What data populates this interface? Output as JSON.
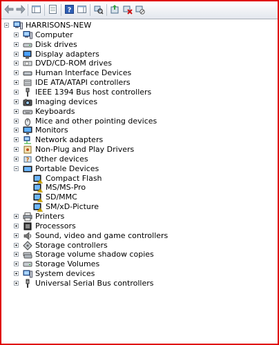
{
  "toolbar": {
    "buttons": [
      {
        "name": "back-arrow-icon"
      },
      {
        "name": "forward-arrow-icon"
      },
      {
        "name": "show-hide-console-tree-icon"
      },
      {
        "name": "properties-icon"
      },
      {
        "name": "help-icon"
      },
      {
        "name": "action-pane-icon"
      },
      {
        "name": "scan-hardware-changes-icon"
      },
      {
        "name": "update-driver-icon"
      },
      {
        "name": "uninstall-device-icon"
      },
      {
        "name": "disable-device-icon"
      }
    ]
  },
  "tree": {
    "root": "HARRISONS-NEW",
    "categories": [
      {
        "label": "Computer",
        "icon": "computer-icon"
      },
      {
        "label": "Disk drives",
        "icon": "disk-drive-icon"
      },
      {
        "label": "Display adapters",
        "icon": "display-adapter-icon"
      },
      {
        "label": "DVD/CD-ROM drives",
        "icon": "dvd-drive-icon"
      },
      {
        "label": "Human Interface Devices",
        "icon": "hid-icon"
      },
      {
        "label": "IDE ATA/ATAPI controllers",
        "icon": "ide-controller-icon"
      },
      {
        "label": "IEEE 1394 Bus host controllers",
        "icon": "ieee1394-icon"
      },
      {
        "label": "Imaging devices",
        "icon": "camera-icon"
      },
      {
        "label": "Keyboards",
        "icon": "keyboard-icon"
      },
      {
        "label": "Mice and other pointing devices",
        "icon": "mouse-icon"
      },
      {
        "label": "Monitors",
        "icon": "monitor-icon"
      },
      {
        "label": "Network adapters",
        "icon": "network-adapter-icon"
      },
      {
        "label": "Non-Plug and Play Drivers",
        "icon": "driver-icon"
      },
      {
        "label": "Other devices",
        "icon": "unknown-device-icon"
      },
      {
        "label": "Portable Devices",
        "icon": "portable-device-icon",
        "expanded": true,
        "children": [
          {
            "label": "Compact Flash",
            "icon": "portable-device-warning-icon"
          },
          {
            "label": "MS/MS-Pro",
            "icon": "portable-device-warning-icon"
          },
          {
            "label": "SD/MMC",
            "icon": "portable-device-warning-icon"
          },
          {
            "label": "SM/xD-Picture",
            "icon": "portable-device-warning-icon"
          }
        ]
      },
      {
        "label": "Printers",
        "icon": "printer-icon"
      },
      {
        "label": "Processors",
        "icon": "processor-icon"
      },
      {
        "label": "Sound, video and game controllers",
        "icon": "speaker-icon"
      },
      {
        "label": "Storage controllers",
        "icon": "storage-controller-icon"
      },
      {
        "label": "Storage volume shadow copies",
        "icon": "shadow-copy-icon"
      },
      {
        "label": "Storage Volumes",
        "icon": "storage-volume-icon"
      },
      {
        "label": "System devices",
        "icon": "system-device-icon"
      },
      {
        "label": "Universal Serial Bus controllers",
        "icon": "usb-icon"
      }
    ]
  }
}
